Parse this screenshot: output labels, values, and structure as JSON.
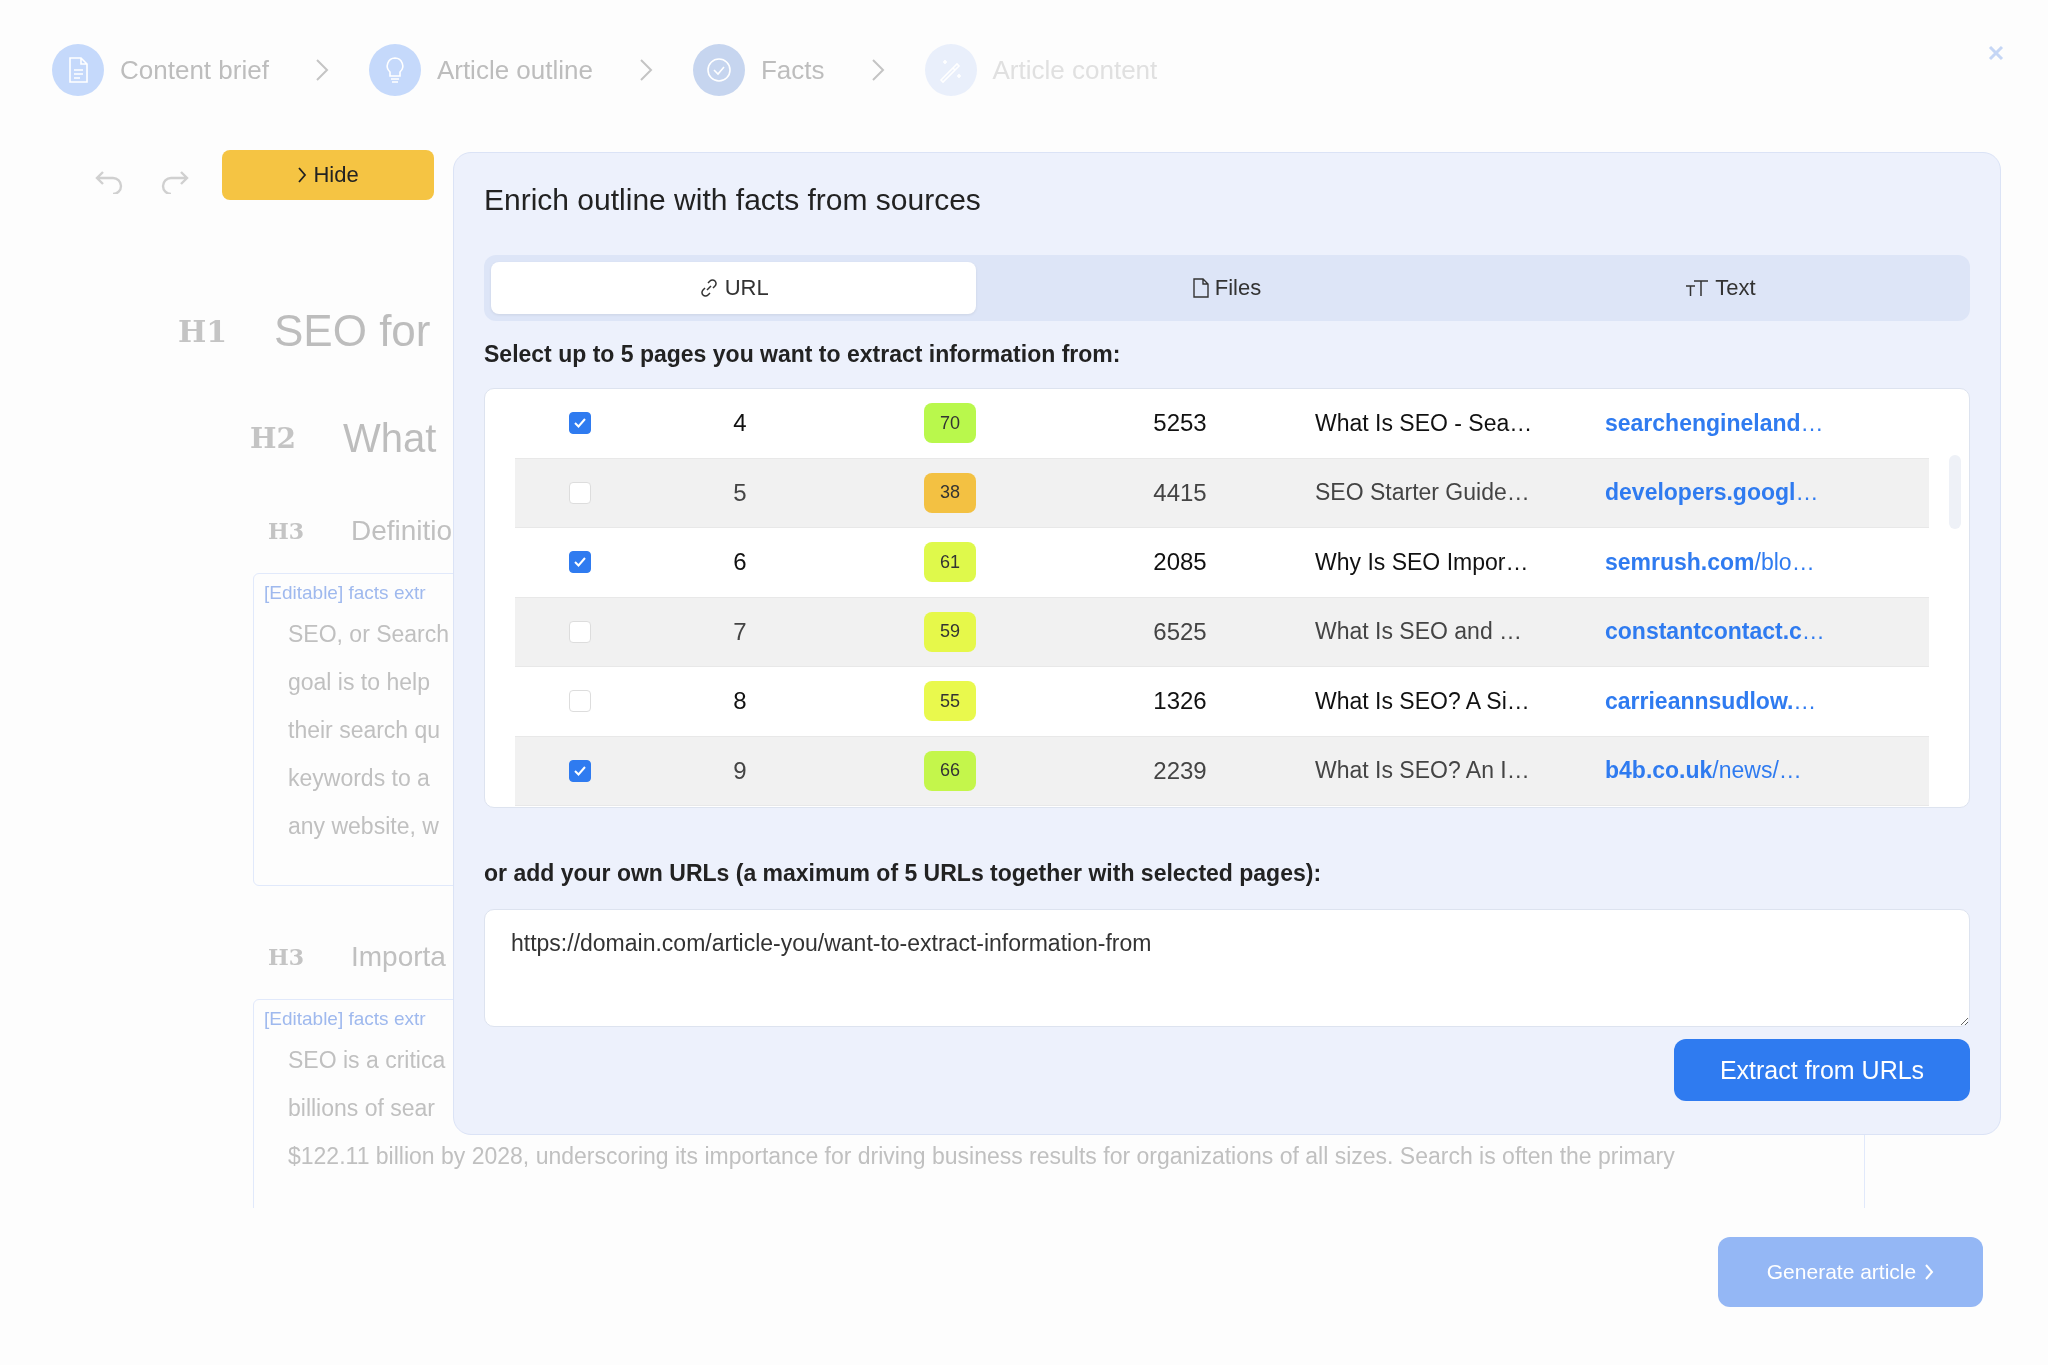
{
  "steps": [
    {
      "label": "Content brief",
      "kind": "done"
    },
    {
      "label": "Article outline",
      "kind": "done"
    },
    {
      "label": "Facts",
      "kind": "current"
    },
    {
      "label": "Article content",
      "kind": "pending"
    }
  ],
  "hide_button": "Hide",
  "editor": {
    "h1": {
      "tag": "H1",
      "text": "SEO for"
    },
    "h2": {
      "tag": "H2",
      "text": "What"
    },
    "sections": [
      {
        "tag": "H3",
        "heading": "Definitio",
        "label": "[Editable] facts extr",
        "lines": [
          "SEO, or Search",
          "goal is to help",
          "their search qu",
          "keywords to a",
          "any website, w"
        ]
      },
      {
        "tag": "H3",
        "heading": "Importa",
        "label": "[Editable] facts extr",
        "lines": [
          "SEO is a critica",
          "billions of sear",
          "$122.11 billion by 2028, underscoring its importance for driving business results for organizations of all sizes. Search is often the primary"
        ]
      }
    ]
  },
  "modal": {
    "title": "Enrich outline with facts from sources",
    "tabs": [
      {
        "label": "URL",
        "selected": true
      },
      {
        "label": "Files",
        "selected": false
      },
      {
        "label": "Text",
        "selected": false
      }
    ],
    "select_label": "Select up to 5 pages you want to extract information from:",
    "rows": [
      {
        "checked": true,
        "rank": "4",
        "score": "70",
        "color": "#b9f84c",
        "words": "5253",
        "title": "What Is SEO - Sea…",
        "domain": "**searchengineland**…"
      },
      {
        "checked": false,
        "rank": "5",
        "score": "38",
        "color": "#f3c142",
        "words": "4415",
        "title": "SEO Starter Guide…",
        "domain": "**developers.googl**…"
      },
      {
        "checked": true,
        "rank": "6",
        "score": "61",
        "color": "#dff94b",
        "words": "2085",
        "title": "Why Is SEO Impor…",
        "domain": "**semrush.com**/blo…"
      },
      {
        "checked": false,
        "rank": "7",
        "score": "59",
        "color": "#e6f84a",
        "words": "6525",
        "title": "What Is SEO and …",
        "domain": "**constantcontact.c**…"
      },
      {
        "checked": false,
        "rank": "8",
        "score": "55",
        "color": "#e9f94d",
        "words": "1326",
        "title": "What Is SEO? A Si…",
        "domain": "**carrieannsudlow.**…"
      },
      {
        "checked": true,
        "rank": "9",
        "score": "66",
        "color": "#c4f64b",
        "words": "2239",
        "title": "What Is SEO? An I…",
        "domain": "**b4b.co.uk**/news/…"
      }
    ],
    "urls_label": "or add your own URLs (a maximum of 5 URLs together with selected pages):",
    "urls_placeholder": "https://domain.com/article-you/want-to-extract-information-from",
    "extract_button": "Extract from URLs"
  },
  "generate_button": "Generate article"
}
